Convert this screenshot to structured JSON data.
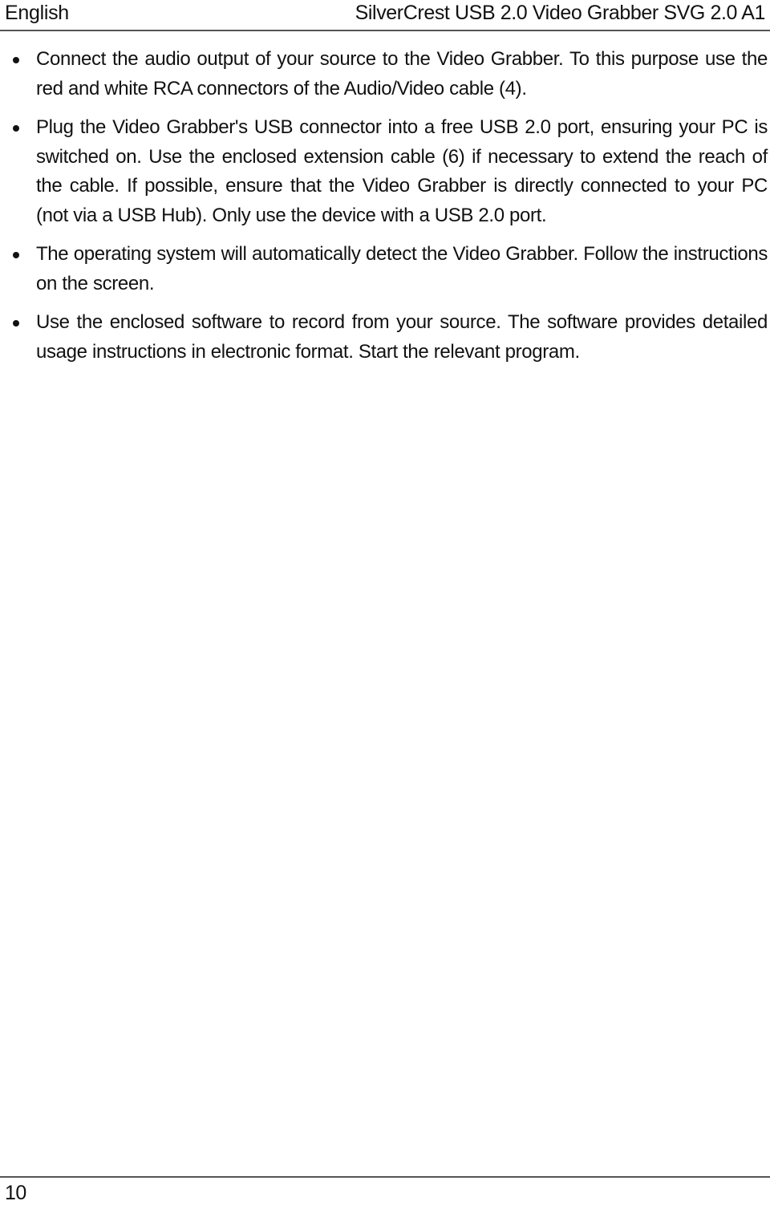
{
  "header": {
    "language": "English",
    "product_title": "SilverCrest USB 2.0 Video Grabber SVG 2.0 A1"
  },
  "content": {
    "bullets": [
      {
        "icon": "bullet-dot",
        "text": "Connect the audio output of your source to the Video Grabber. To this purpose use the red and white RCA connectors of the Audio/Video cable (4)."
      },
      {
        "icon": "bullet-dot",
        "text": "Plug the Video Grabber's USB connector into a free USB 2.0 port, ensuring your PC is switched on. Use the enclosed extension cable (6) if necessary to extend the reach of the cable. If possible, ensure that the Video Grabber is directly connected to your PC (not via a USB Hub). Only use the device with a USB 2.0 port."
      },
      {
        "icon": "bullet-dot",
        "text": "The operating system will automatically detect the Video Grabber. Follow the instructions on the screen."
      },
      {
        "icon": "bullet-dot",
        "text": "Use the enclosed software to record from your source. The software provides detailed usage instructions in electronic format. Start the relevant program."
      }
    ]
  },
  "footer": {
    "page_number": "10"
  }
}
